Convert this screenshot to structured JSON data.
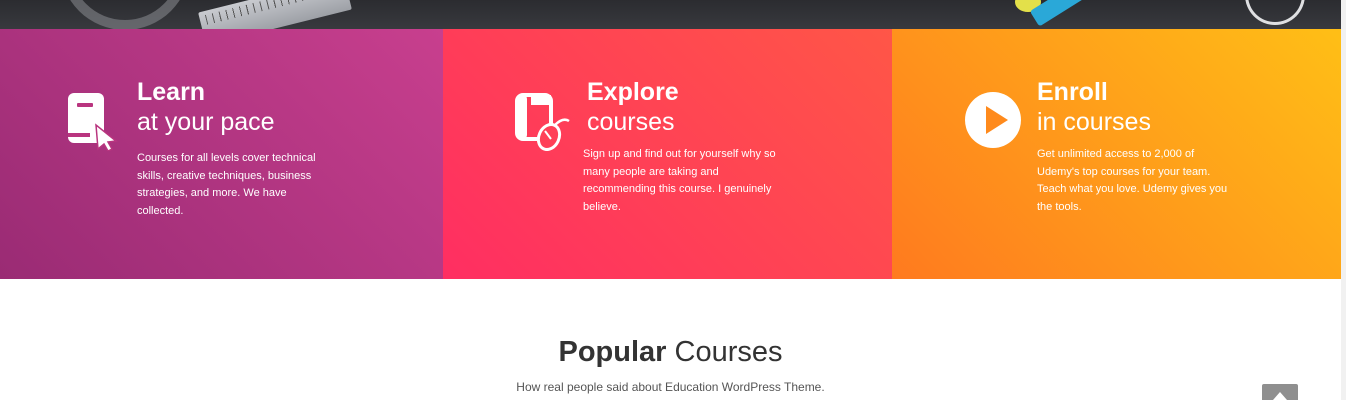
{
  "features": [
    {
      "title_bold": "Learn",
      "title_light": "at your pace",
      "description": "Courses for all levels cover technical skills, creative techniques, business strategies, and more. We have collected.",
      "icon": "book-cursor-icon",
      "gradient": [
        "#9a2b74",
        "#c83f8e"
      ]
    },
    {
      "title_bold": "Explore",
      "title_light": "courses",
      "description": "Sign up and find out for yourself why so many people are taking and recommending this course. I genuinely believe.",
      "icon": "book-mouse-icon",
      "gradient": [
        "#ff2e62",
        "#ff5647"
      ]
    },
    {
      "title_bold": "Enroll",
      "title_light": "in courses",
      "description": "Get unlimited access to 2,000 of Udemy's top courses for your team. Teach what you love. Udemy gives you the tools.",
      "icon": "play-circle-icon",
      "gradient": [
        "#ff7a1f",
        "#ffbf16"
      ]
    }
  ],
  "popular": {
    "title_bold": "Popular",
    "title_rest": "Courses",
    "subtitle": "How real people said about Education WordPress Theme."
  },
  "scroll_top_icon": "arrow-up-icon"
}
